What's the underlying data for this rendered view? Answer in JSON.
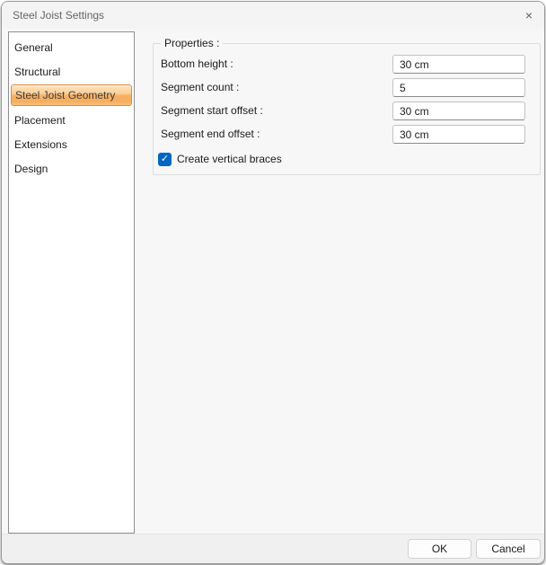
{
  "window": {
    "title": "Steel Joist Settings",
    "close_icon": "×"
  },
  "sidebar": {
    "items": [
      {
        "label": "General",
        "selected": false
      },
      {
        "label": "Structural",
        "selected": false
      },
      {
        "label": "Steel Joist Geometry",
        "selected": true
      },
      {
        "label": "Placement",
        "selected": false
      },
      {
        "label": "Extensions",
        "selected": false
      },
      {
        "label": "Design",
        "selected": false
      }
    ]
  },
  "properties": {
    "group_label": "Properties :",
    "fields": [
      {
        "label": "Bottom height :",
        "value": "30 cm"
      },
      {
        "label": "Segment count :",
        "value": "5"
      },
      {
        "label": "Segment start offset :",
        "value": "30 cm"
      },
      {
        "label": "Segment end offset :",
        "value": "30 cm"
      }
    ],
    "checkbox": {
      "label": "Create vertical braces",
      "checked": true,
      "check_glyph": "✓"
    }
  },
  "footer": {
    "ok_label": "OK",
    "cancel_label": "Cancel"
  },
  "colors": {
    "selected_item_border": "#d78d43",
    "selected_item_gradient_top": "#fde3c0",
    "selected_item_gradient_bottom": "#f9c077",
    "checkbox_accent": "#0067c0",
    "dialog_background": "#f7f7f7",
    "footer_background": "#f0f0f0"
  }
}
